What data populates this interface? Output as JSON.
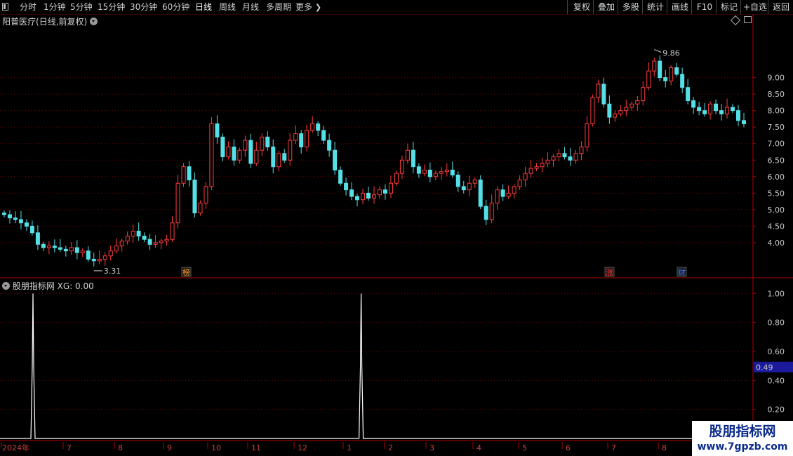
{
  "toolbar": {
    "periods": [
      "分时",
      "1分钟",
      "5分钟",
      "15分钟",
      "30分钟",
      "60分钟",
      "日线",
      "周线",
      "月线",
      "多周期"
    ],
    "more": "更多",
    "active": "日线",
    "right_buttons": [
      "复权",
      "叠加",
      "多股",
      "统计",
      "画线",
      "F10",
      "标记",
      "+自选",
      "返回"
    ]
  },
  "main_panel": {
    "stock_name": "阳普医疗",
    "mode": "(日线,前复权)",
    "high_marker": "9.86",
    "low_marker": "3.31",
    "badges": [
      {
        "label": "榜",
        "color": "#ff9a1f"
      },
      {
        "label": "涨",
        "color": "#ff3030"
      },
      {
        "label": "财",
        "color": "#3a7cff"
      }
    ],
    "y_ticks": [
      "9.00",
      "8.50",
      "8.00",
      "7.50",
      "7.00",
      "6.50",
      "6.00",
      "5.50",
      "5.00",
      "4.50",
      "4.00"
    ]
  },
  "indicator_panel": {
    "name": "股朋指标网",
    "value_label": "XG: 0.00",
    "y_ticks": [
      "1.00",
      "0.80",
      "0.60",
      "0.40",
      "0.20"
    ],
    "cursor_value": "0.49"
  },
  "x_axis": {
    "labels": [
      "2024年",
      "7",
      "8",
      "9",
      "10",
      "11",
      "12",
      "1",
      "2",
      "3",
      "4",
      "5",
      "6",
      "7",
      "8"
    ]
  },
  "watermark": {
    "line1": "股朋指标网",
    "line2": "www.7gpzb.com"
  },
  "colors": {
    "up": "#ff3d3d",
    "down": "#54e0e6",
    "grid": "#7a0000",
    "axis": "#b00000",
    "cursor_box": "#1a1a9a"
  },
  "chart_data": [
    {
      "type": "candlestick",
      "title": "阳普医疗 (日线,前复权)",
      "ylim": [
        3.0,
        10.5
      ],
      "y_ticks": [
        4.0,
        4.5,
        5.0,
        5.5,
        6.0,
        6.5,
        7.0,
        7.5,
        8.0,
        8.5,
        9.0
      ],
      "x_months": [
        "2024年",
        "7",
        "8",
        "9",
        "10",
        "11",
        "12",
        "1",
        "2",
        "3",
        "4",
        "5",
        "6",
        "7",
        "8"
      ],
      "max_label": 9.86,
      "min_label": 3.31,
      "close_path": [
        4.85,
        4.75,
        4.7,
        4.6,
        4.5,
        4.3,
        3.95,
        3.85,
        3.9,
        3.85,
        3.8,
        3.75,
        3.85,
        3.7,
        3.75,
        3.5,
        3.45,
        3.5,
        3.6,
        3.75,
        3.9,
        4.05,
        4.2,
        4.35,
        4.2,
        4.1,
        3.95,
        4.0,
        4.05,
        4.1,
        4.6,
        5.8,
        6.3,
        5.9,
        4.9,
        5.2,
        5.7,
        7.6,
        7.2,
        6.6,
        6.9,
        6.5,
        6.8,
        7.1,
        6.4,
        6.8,
        7.2,
        6.9,
        6.3,
        6.7,
        6.5,
        7.1,
        7.3,
        6.9,
        7.4,
        7.6,
        7.4,
        7.1,
        6.8,
        6.2,
        5.8,
        5.6,
        5.4,
        5.3,
        5.5,
        5.35,
        5.45,
        5.6,
        5.5,
        5.8,
        6.1,
        6.5,
        6.8,
        6.3,
        6.1,
        6.2,
        6.0,
        6.1,
        6.15,
        6.2,
        6.05,
        5.7,
        5.6,
        5.8,
        5.9,
        5.1,
        4.7,
        5.2,
        5.6,
        5.4,
        5.5,
        5.7,
        5.9,
        6.1,
        6.25,
        6.3,
        6.4,
        6.5,
        6.6,
        6.7,
        6.6,
        6.5,
        6.7,
        6.9,
        7.6,
        8.4,
        8.8,
        8.2,
        7.8,
        7.9,
        8.0,
        8.1,
        8.2,
        8.3,
        8.7,
        9.2,
        9.5,
        9.0,
        8.9,
        9.3,
        9.1,
        8.7,
        8.3,
        8.1,
        8.0,
        7.9,
        8.2,
        8.0,
        7.9,
        8.1,
        8.0,
        7.7,
        7.6
      ]
    },
    {
      "type": "line",
      "title": "股朋指标网 XG",
      "ylim": [
        0,
        1.05
      ],
      "y_ticks": [
        0.2,
        0.4,
        0.6,
        0.8,
        1.0
      ],
      "series": [
        {
          "name": "XG",
          "spikes": [
            {
              "month_index": 0.5,
              "value": 1.0
            },
            {
              "month_index": 7.4,
              "value": 1.0
            }
          ]
        }
      ],
      "current_value": 0.0
    }
  ]
}
